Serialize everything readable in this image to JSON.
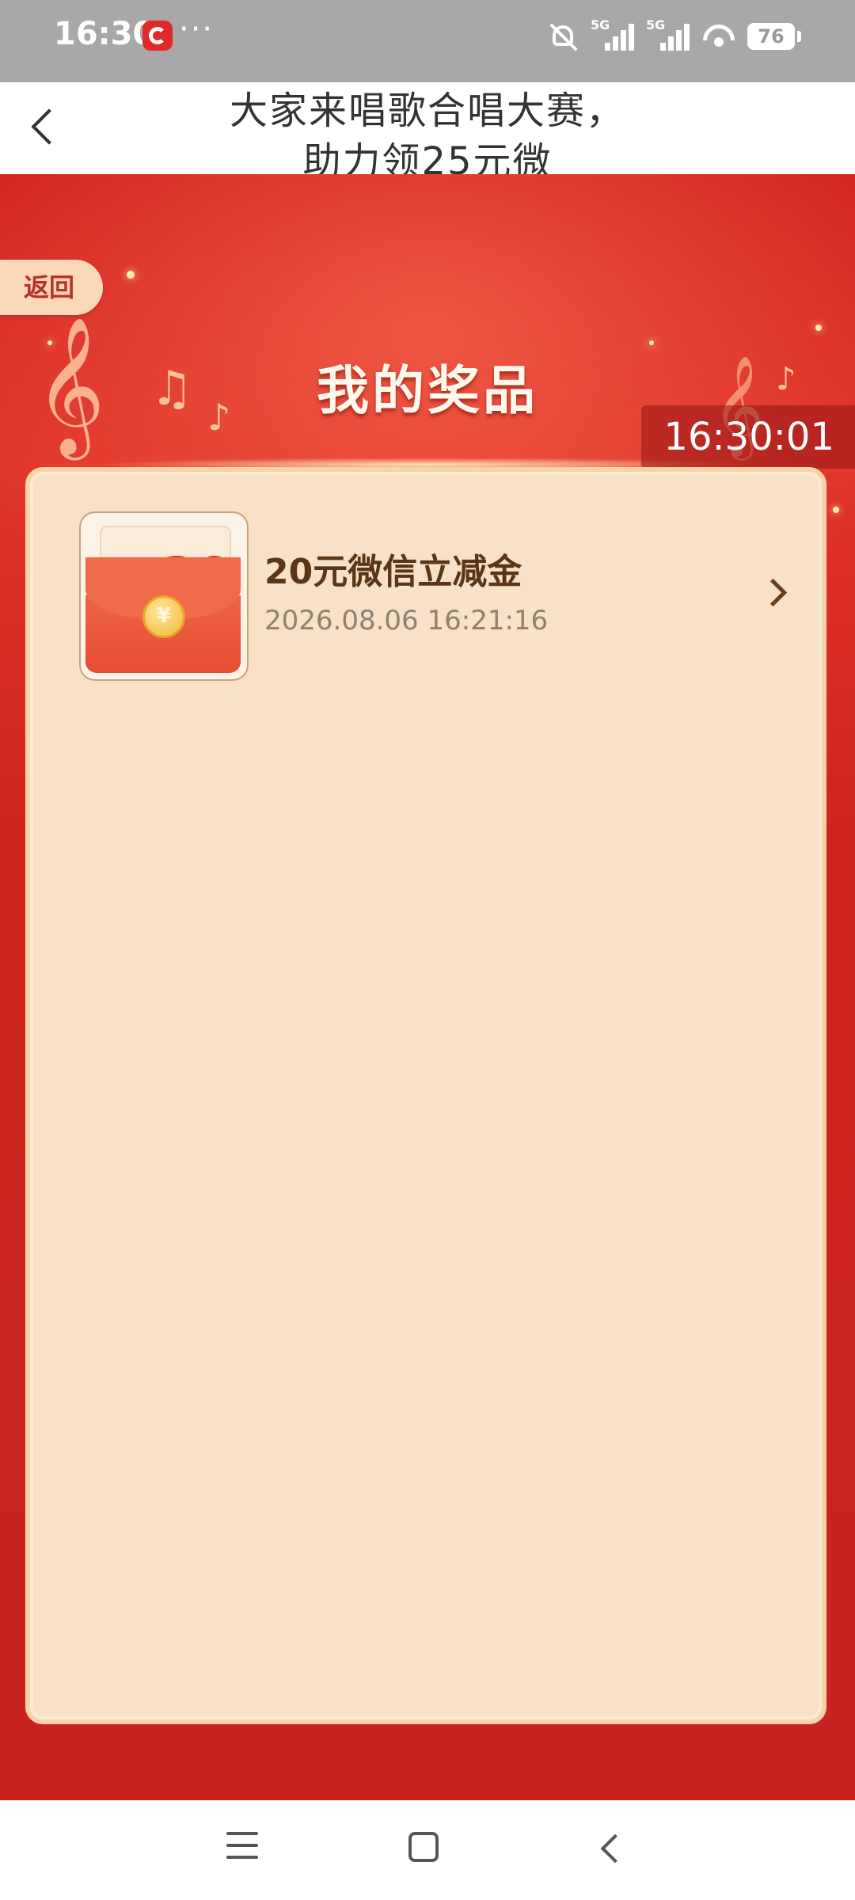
{
  "status_bar": {
    "time": "16:30",
    "dots": "···",
    "signal_tag": "5G",
    "battery": "76"
  },
  "header": {
    "title": "大家来唱歌合唱大赛，助力领25元微"
  },
  "banner": {
    "back_label": "返回",
    "title": "我的奖品",
    "clock": "16:30:01"
  },
  "prizes": [
    {
      "thumb_currency": "¥",
      "thumb_amount": "20",
      "coin_symbol": "¥",
      "name": "20元微信立减金",
      "date": "2026.08.06 16:21:16"
    }
  ],
  "colors": {
    "primary_red": "#d32421",
    "card_bg": "#f8e1c6",
    "prize_text": "#5a3616"
  }
}
